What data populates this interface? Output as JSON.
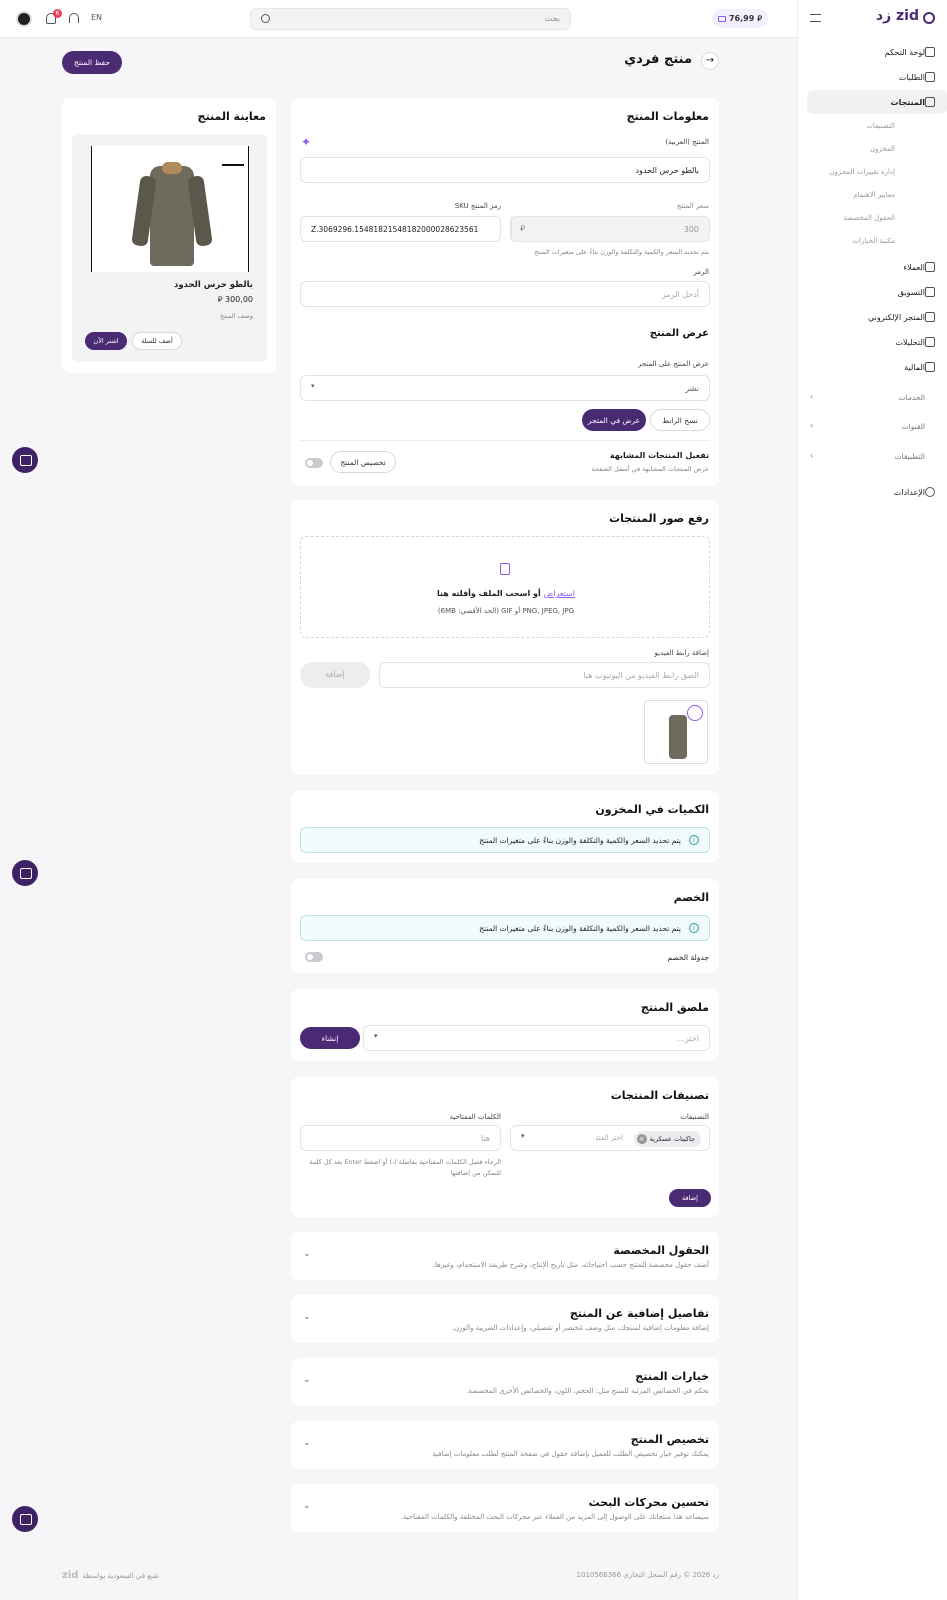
{
  "topbar": {
    "balance": "76,99",
    "currency_symbol": "⃁",
    "search_placeholder": "بحث",
    "lang": "EN",
    "notif_count": "6"
  },
  "sidebar": {
    "logo": "زد zid",
    "items": [
      {
        "label": "لوحة التحكم",
        "icon": "dashboard-icon"
      },
      {
        "label": "الطلبات",
        "icon": "cart-icon"
      },
      {
        "label": "المنتجات",
        "icon": "products-icon",
        "active": true
      }
    ],
    "sub_items": [
      "التصنيفات",
      "المخزون",
      "إدارة تغييرات المخزون",
      "معايير الاهتمام",
      "الحقول المخصصة",
      "مكتبة الخيارات"
    ],
    "items2": [
      {
        "label": "العملاء",
        "icon": "users-icon"
      },
      {
        "label": "التسويق",
        "icon": "megaphone-icon"
      },
      {
        "label": "المتجر الإلكتروني",
        "icon": "store-icon"
      },
      {
        "label": "التحليلات",
        "icon": "chart-icon"
      },
      {
        "label": "المالية",
        "icon": "wallet-icon"
      }
    ],
    "groups": [
      "الخدمات",
      "القنوات",
      "التطبيقات"
    ],
    "settings": "الإعدادات"
  },
  "page": {
    "title": "منتج فردي",
    "save_button": "حفظ المنتج"
  },
  "product_info": {
    "title": "معلومات المنتج",
    "name_label": "المنتج (العربية)",
    "name_value": "بالطو حرس الحدود",
    "price_label": "سعر المنتج",
    "price_value": "300",
    "sku_label": "رمز المنتج SKU",
    "sku_value": "Z.3069296.15481821548182000028623561",
    "price_hint": "يتم تحديد السعر والكمية والتكلفة والوزن بناءً على متغيرات المنتج",
    "code_label": "الرمز",
    "code_placeholder": "أدخل الرمز",
    "display_title": "عرض المنتج",
    "display_label": "عرض المنتج على المتجر",
    "display_value": "نشر",
    "view_button": "عرض في المتجر",
    "copy_button": "نسخ الرابط",
    "similar_title": "تفعيل المنتجات المشابهة",
    "similar_desc": "عرض المنتجات المشابهة في أسفل الصفحة",
    "customize_button": "تخصيص المنتج"
  },
  "preview": {
    "title": "معاينة المنتج",
    "product_name": "بالطو حرس الحدود",
    "price": "300,00",
    "desc": "وصف المنتج",
    "buy_button": "اشتر الآن",
    "cart_button": "أضف للسلة"
  },
  "upload": {
    "title": "رفع صور المنتجات",
    "browse": "استعراض",
    "drop_text": "أو اسحب الملف وأفلته هنا",
    "formats": "(6MB :الحد الأقصى) GIF أو PNG, JPEG, JPG",
    "video_label": "إضافة رابط الفيديو",
    "video_placeholder": "الصق رابط الفيديو من اليوتيوب هنا",
    "add_button": "إضافة"
  },
  "stock": {
    "title": "الكميات في المخزون",
    "info": "يتم تحديد السعر والكمية والتكلفة والوزن بناءً على متغيرات المنتج"
  },
  "discount": {
    "title": "الخصم",
    "info": "يتم تحديد السعر والكمية والتكلفة والوزن بناءً على متغيرات المنتج",
    "schedule_label": "جدولة الخصم"
  },
  "sticker": {
    "title": "ملصق المنتج",
    "placeholder": "اختر...",
    "create_button": "إنشاء"
  },
  "categories": {
    "title": "تصنيفات المنتجات",
    "cat_label": "التصنيفات",
    "cat_chip": "جاكيتات عسكرية",
    "cat_placeholder": "اختر الفئة",
    "kw_label": "الكلمات المفتاحية",
    "kw_placeholder": "هنا",
    "kw_hint": "الرجاء فصل الكلمات المفتاحية بفاصلة (،) أو اضغط Enter بعد كل كلمة للتمكن من إضافتها",
    "add_button": "إضافة"
  },
  "accordions": [
    {
      "title": "الحقول المخصصة",
      "desc": "أضف حقول مخصصة للمنتج حسب احتياجاته، مثل تاريخ الإنتاج، وشرح طريقة الاستخدام، وغيرها."
    },
    {
      "title": "تفاصيل إضافية عن المنتج",
      "desc": "إضافة معلومات إضافية لمنتجك، مثل وصف مُختصر أو تفصيلي، وإعدادات الضريبة والوزن."
    },
    {
      "title": "خيارات المنتج",
      "desc": "تحكم في الخصائص المرئية للمنتج مثل: الحجم، اللون، والخصائص الأخرى المخصصة."
    },
    {
      "title": "تخصيص المنتج",
      "desc": "يمكنك توفير خيار تخصيص الطلب للعميل بإضافة حقول في صفحة المنتج لطلب معلومات إضافية"
    },
    {
      "title": "تحسين محركات البحث",
      "desc": "سيساعد هذا منتجاتك على الوصول إلى المزيد من العملاء عبر محركات البحث المختلفة والكلمات المفتاحية."
    }
  ],
  "footer": {
    "left": "صُنع في السعودية بواسطة",
    "brand": "zid",
    "right": "زد 2026 © رقم السجل التجاري 1010566366"
  },
  "colors": {
    "primary": "#4b2a74",
    "accent": "#8b5cf6",
    "info_bg": "#f0fbfb"
  }
}
